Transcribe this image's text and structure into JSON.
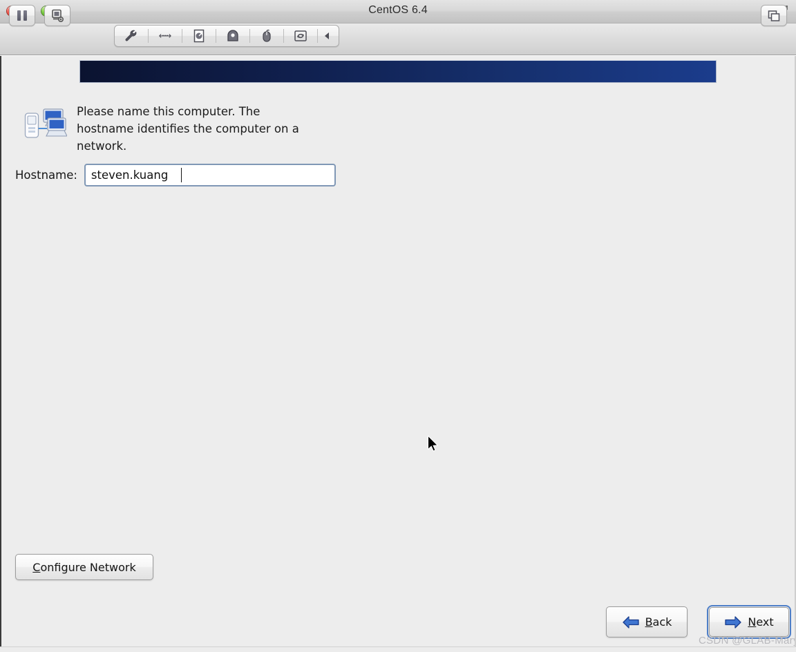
{
  "window": {
    "title": "CentOS 6.4",
    "traffic_lights": [
      {
        "name": "close",
        "color": "#f2564b"
      },
      {
        "name": "minimize",
        "color": "#f2bd2f"
      },
      {
        "name": "zoom",
        "color": "#79ca42"
      }
    ],
    "fullscreen_icon": "fullscreen-expand-icon"
  },
  "toolbar": {
    "left_buttons": [
      {
        "name": "pause-button",
        "icon": "pause-icon"
      },
      {
        "name": "snapshot-button",
        "icon": "snapshot-camera-icon"
      }
    ],
    "device_group": [
      {
        "name": "settings-button",
        "icon": "wrench-icon"
      },
      {
        "name": "network-button",
        "icon": "network-arrows-icon"
      },
      {
        "name": "harddisk-button",
        "icon": "hard-disk-icon"
      },
      {
        "name": "cdrom-button",
        "icon": "cd-drive-icon"
      },
      {
        "name": "mouse-button",
        "icon": "mouse-icon"
      },
      {
        "name": "shared-folders-button",
        "icon": "sync-refresh-icon"
      },
      {
        "name": "collapse-toolbar-button",
        "icon": "chevron-left-icon"
      }
    ],
    "right_buttons": [
      {
        "name": "unity-windows-button",
        "icon": "windows-layers-icon"
      }
    ]
  },
  "installer": {
    "banner_gradient_from": "#0b1330",
    "banner_gradient_to": "#1b3c8c",
    "prompt_icon": "network-computers-icon",
    "prompt_text": "Please name this computer.  The\nhostname identifies the computer on a\nnetwork.",
    "hostname_label": "Hostname:",
    "hostname_value": "steven.kuang",
    "hostname_placeholder": "",
    "configure_network_label_mnemonic": "C",
    "configure_network_label_rest": "onfigure Network",
    "back_label_mnemonic": "B",
    "back_label_rest": "ack",
    "next_label_mnemonic": "N",
    "next_label_rest": "ext",
    "accent_color": "#1b3c8c",
    "focus_ring_color": "#4f7fc8"
  },
  "overlay": {
    "watermark": "CSDN @GLAB-Mary",
    "cursor_icon": "mouse-pointer-arrow"
  }
}
